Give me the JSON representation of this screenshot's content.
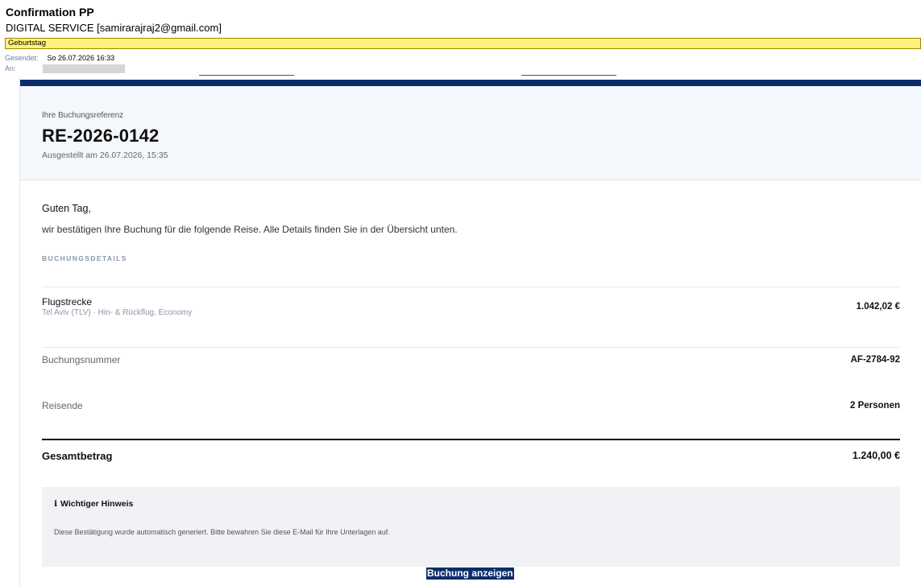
{
  "mail": {
    "subject": "Confirmation PP",
    "sender": "DIGITAL SERVICE [samirarajraj2@gmail.com]",
    "category": "Geburtstag",
    "sent_label": "Gesendet:",
    "sent_value": "So 26.07.2026 16:33",
    "to_label": "An:"
  },
  "booking": {
    "ref_label": "Ihre Buchungsreferenz",
    "ref_number": "RE-2026-0142",
    "issued": "Ausgestellt am 26.07.2026, 15:35",
    "greeting": "Guten Tag,",
    "intro": "wir bestätigen Ihre Buchung für die folgende Reise. Alle Details finden Sie in der Übersicht unten.",
    "section_title": "BUCHUNGSDETAILS",
    "rows": [
      {
        "label": "Flugstrecke",
        "sub": "Tel Aviv (TLV) · Hin- & Rückflug, Economy",
        "value": "1.042,02 €"
      },
      {
        "label": "Buchungsnummer",
        "value": "AF-2784-92"
      },
      {
        "label": "Reisende",
        "value": "2 Personen"
      }
    ],
    "total_label": "Gesamtbetrag",
    "total_value": "1.240,00 €",
    "notice_icon": "ℹ︎",
    "notice_title": "Wichtiger Hinweis",
    "notice_text": "Diese Bestätigung wurde automatisch generiert. Bitte bewahren Sie diese E-Mail für Ihre Unterlagen auf.",
    "cta_label": "Buchung anzeigen"
  },
  "colors": {
    "brand_navy": "#0c2d6b",
    "category_yellow": "#fff27a"
  }
}
